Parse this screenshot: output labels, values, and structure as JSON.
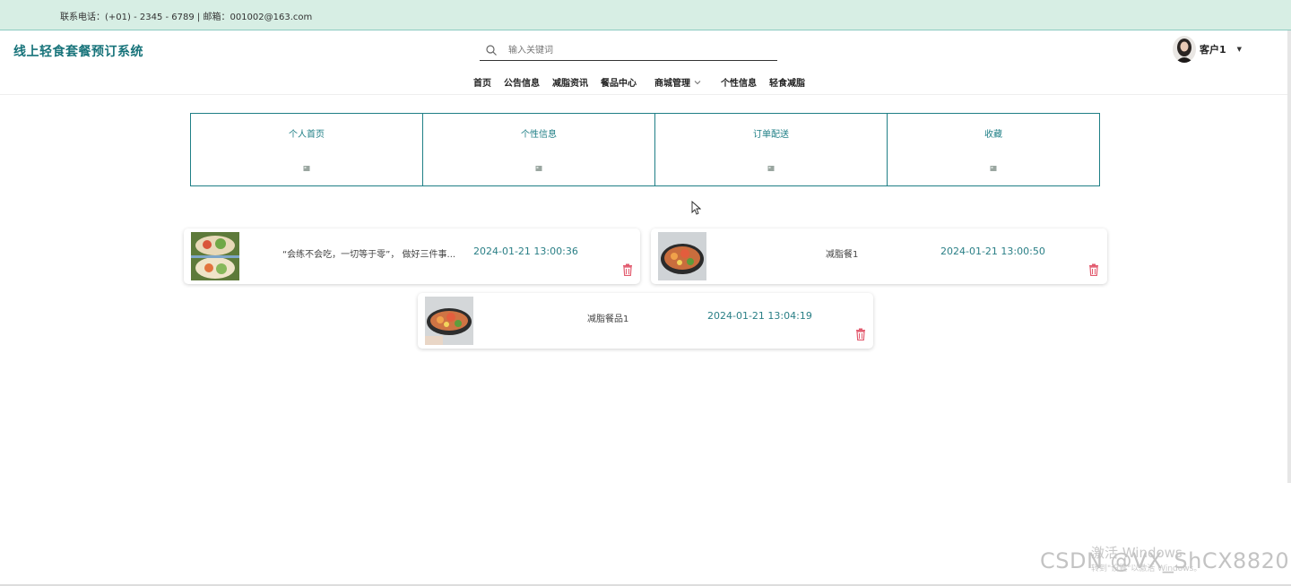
{
  "topbar": {
    "contact": "联系电话：(+01) - 2345 - 6789 | 邮箱：001002@163.com"
  },
  "header": {
    "site_title": "线上轻食套餐预订系统",
    "search_placeholder": "输入关键词",
    "username": "客户1"
  },
  "nav": {
    "items": [
      "首页",
      "公告信息",
      "减脂资讯",
      "餐品中心",
      "商城管理",
      "个性信息",
      "轻食减脂"
    ]
  },
  "panels": [
    {
      "label": "个人首页"
    },
    {
      "label": "个性信息"
    },
    {
      "label": "订单配送"
    },
    {
      "label": "收藏"
    }
  ],
  "favorites": [
    {
      "title": "“会练不会吃，一切等于零”， 做好三件事...",
      "time": "2024-01-21 13:00:36"
    },
    {
      "title": "减脂餐1",
      "time": "2024-01-21 13:00:50"
    },
    {
      "title": "减脂餐品1",
      "time": "2024-01-21 13:04:19"
    }
  ],
  "watermark": {
    "activate_line1": "激活 Windows",
    "activate_line2": "转到\"设置\"以激活 Windows。",
    "csdn": "CSDN @VX_ShCX8820"
  },
  "colors": {
    "accent": "#1f7f86",
    "topbar": "#d7eee4",
    "danger": "#e25a6e"
  }
}
